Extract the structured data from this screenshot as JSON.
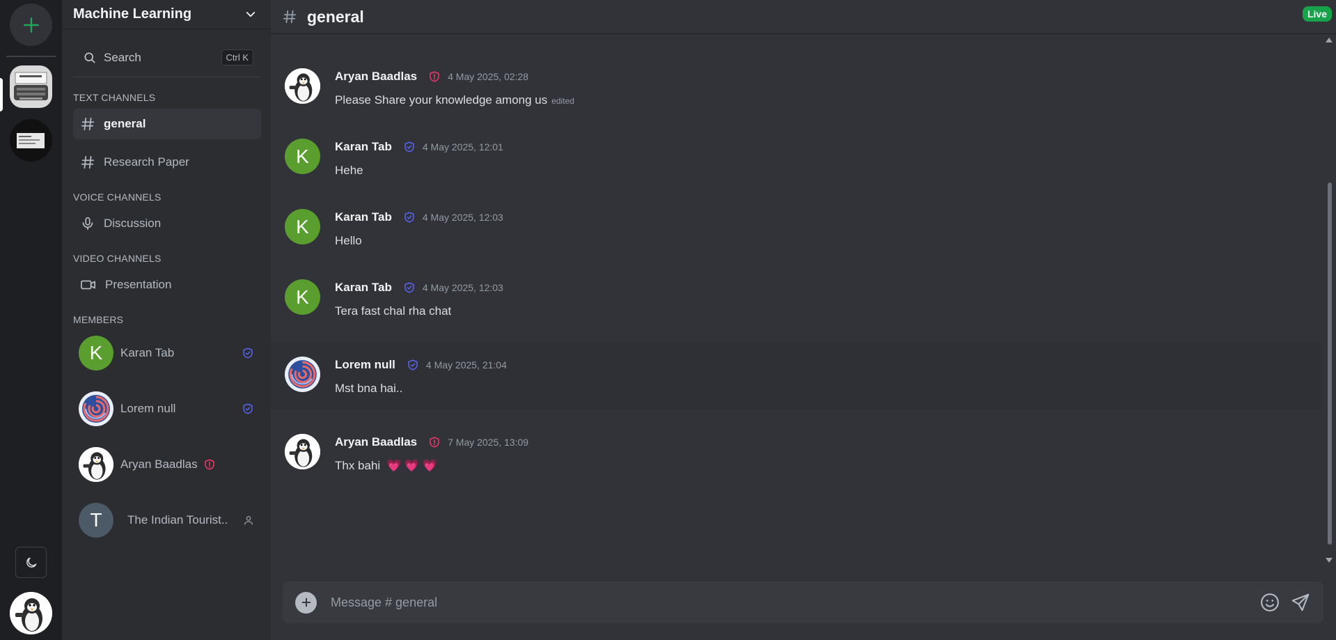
{
  "server": {
    "name": "Machine Learning"
  },
  "search": {
    "label": "Search",
    "shortcut": "Ctrl K"
  },
  "sections": {
    "text": "TEXT CHANNELS",
    "voice": "VOICE CHANNELS",
    "video": "VIDEO CHANNELS",
    "members": "MEMBERS"
  },
  "channels": {
    "text": [
      {
        "label": "general",
        "active": true
      },
      {
        "label": "Research Paper",
        "active": false
      }
    ],
    "voice": [
      {
        "label": "Discussion"
      }
    ],
    "video": [
      {
        "label": "Presentation"
      }
    ]
  },
  "members": [
    {
      "name": "Karan Tab",
      "initial": "K",
      "role_icon": "shield-check-icon",
      "avatar_color": "#5a9e2f"
    },
    {
      "name": "Lorem null",
      "initial": "",
      "role_icon": "shield-check-icon",
      "avatar_color": "#3a5ca8"
    },
    {
      "name": "Aryan Baadlas",
      "initial": "",
      "role_icon": "shield-alert-icon",
      "avatar_color": "#ffffff"
    },
    {
      "name": "The Indian Tourist..",
      "initial": "T",
      "role_icon": "user-icon",
      "avatar_color": "#4b5a66"
    }
  ],
  "header": {
    "channel": "general",
    "live": "Live"
  },
  "messages": [
    {
      "author": "Aryan Baadlas",
      "time": "4 May 2025, 02:28",
      "text": "Please Share your knowledge among us",
      "edited": "edited",
      "badge": "shield-alert-icon",
      "avatar": "penguin"
    },
    {
      "author": "Karan Tab",
      "time": "4 May 2025, 12:01",
      "text": "Hehe",
      "badge": "shield-check-icon",
      "avatar": "K"
    },
    {
      "author": "Karan Tab",
      "time": "4 May 2025, 12:03",
      "text": "Hello",
      "badge": "shield-check-icon",
      "avatar": "K"
    },
    {
      "author": "Karan Tab",
      "time": "4 May 2025, 12:03",
      "text": "Tera fast chal rha chat",
      "badge": "shield-check-icon",
      "avatar": "K"
    },
    {
      "author": "Lorem null",
      "time": "4 May 2025, 21:04",
      "text": "Mst bna hai..",
      "badge": "shield-check-icon",
      "avatar": "swirl"
    },
    {
      "author": "Aryan Baadlas",
      "time": "7 May 2025, 13:09",
      "text": "Thx bahi",
      "hearts": "💗 💗 💗",
      "badge": "shield-alert-icon",
      "avatar": "penguin"
    }
  ],
  "composer": {
    "placeholder": "Message # general"
  },
  "colors": {
    "accent_green": "#16a34a",
    "moderator_blue": "#5865f2",
    "admin_red": "#f0386b"
  }
}
